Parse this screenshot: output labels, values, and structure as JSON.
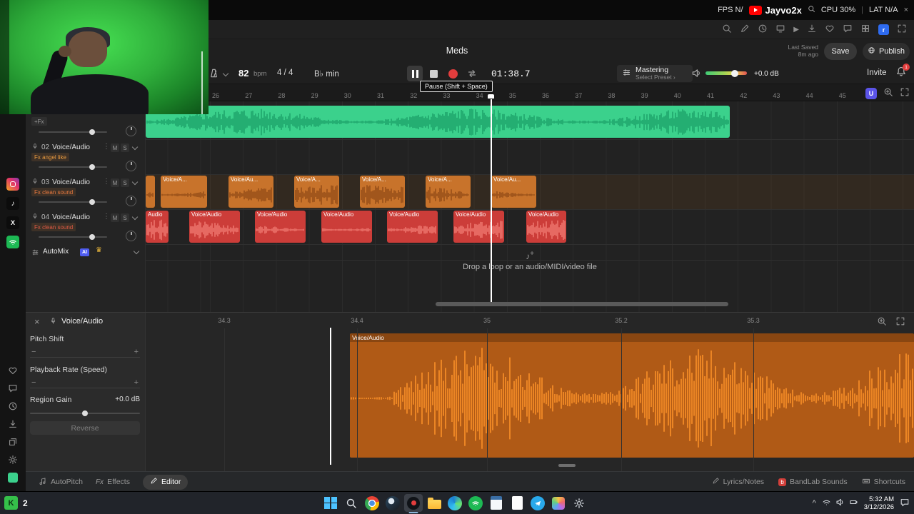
{
  "stream": {
    "fps": "FPS N/",
    "channel": "Jayvo2x",
    "cpu": "CPU 30%",
    "lat": "LAT N/A"
  },
  "header": {
    "title": "Meds",
    "last_saved_label": "Last Saved",
    "last_saved_value": "8m ago",
    "save_label": "Save",
    "publish_label": "Publish"
  },
  "transport": {
    "bpm": "82",
    "bpm_unit": "bpm",
    "time_signature": "4 / 4",
    "key": "B♭ min",
    "time_display": "01:38.7",
    "pause_tooltip": "Pause (Shift + Space)",
    "mastering_label": "Mastering",
    "mastering_sub": "Select Preset ›",
    "volume_db": "+0.0 dB",
    "invite_label": "Invite",
    "notification_count": "1"
  },
  "timeline": {
    "bars": [
      "26",
      "27",
      "28",
      "29",
      "30",
      "31",
      "32",
      "33",
      "34",
      "35",
      "36",
      "37",
      "38",
      "39",
      "40",
      "41",
      "42",
      "43",
      "44",
      "45"
    ],
    "drop_hint": "Drop a loop or an audio/MIDI/video file"
  },
  "tracks": {
    "track1": {
      "fx_add_label": "+Fx"
    },
    "track2": {
      "num": "02",
      "name": "Voice/Audio",
      "fx_label": "Fx angel like",
      "mute": "M",
      "solo": "S"
    },
    "track3": {
      "num": "03",
      "name": "Voice/Audio",
      "fx_label": "Fx clean sound",
      "mute": "M",
      "solo": "S"
    },
    "track4": {
      "num": "04",
      "name": "Voice/Audio",
      "fx_label": "Fx clean sound",
      "mute": "M",
      "solo": "S"
    },
    "automix": {
      "label": "AutoMix",
      "ai_badge": "AI"
    }
  },
  "clips": {
    "orange_labels": [
      "",
      "Voice/A...",
      "Voice/Au...",
      "Voice/A...",
      "Voice/A...",
      "Voice/A...",
      "Voice/Au..."
    ],
    "red_labels": [
      "Audio",
      "Voice/Audio",
      "Voice/Audio",
      "Voice/Audio",
      "Voice/Audio",
      "Voice/Audio",
      "Voice/Audio"
    ]
  },
  "editor": {
    "clip_name": "Voice/Audio",
    "ruler_labels": [
      "34.3",
      "34.4",
      "35",
      "35.2",
      "35.3"
    ],
    "pitch_shift_label": "Pitch Shift",
    "playback_rate_label": "Playback Rate (Speed)",
    "region_gain_label": "Region Gain",
    "region_gain_value": "+0.0 dB",
    "reverse_label": "Reverse",
    "region_label": "Voice/Audio"
  },
  "bottom_bar": {
    "autopitch": "AutoPitch",
    "effects": "Effects",
    "editor": "Editor",
    "lyrics_notes": "Lyrics/Notes",
    "bandlab_sounds": "BandLab Sounds",
    "shortcuts": "Shortcuts"
  },
  "taskbar": {
    "key_overlay": "K",
    "key_count": "2",
    "time": "5:32 AM",
    "date": "3/12/2026",
    "active_app": "obs"
  },
  "icon_sets": {
    "browser_toolbar": [
      "search",
      "pencil",
      "clock",
      "monitor",
      "play",
      "download",
      "heart",
      "chat",
      "grid",
      "r-badge",
      "expand"
    ],
    "sidebar_top": [
      "instagram",
      "tiktok",
      "x",
      "spotify"
    ],
    "sidebar_bottom": [
      "heart",
      "chat",
      "clock",
      "download",
      "layers",
      "gear",
      "bandlab",
      "dots"
    ],
    "taskbar_apps": [
      "start",
      "search",
      "chrome",
      "steam",
      "obs",
      "file-explorer",
      "edge",
      "spotify",
      "calculator",
      "notepad",
      "telegram",
      "photos",
      "settings"
    ],
    "tray": [
      "wifi",
      "speaker",
      "battery"
    ]
  },
  "colors": {
    "clip_green": "#3bd18c",
    "clip_orange": "#c8732b",
    "clip_red": "#cc3d39",
    "editor_region": "#b05a16",
    "record_red": "#e23d3d",
    "accent_blue": "#2e6bf0"
  },
  "glyphs": {
    "play": "▶",
    "dots_v": "⋮",
    "dots_h": "⋯",
    "plus": "+",
    "minus": "−",
    "close": "×",
    "note": "♪",
    "crown": "♛",
    "caret_up": "^",
    "r_badge": "r",
    "u_badge": "U"
  }
}
